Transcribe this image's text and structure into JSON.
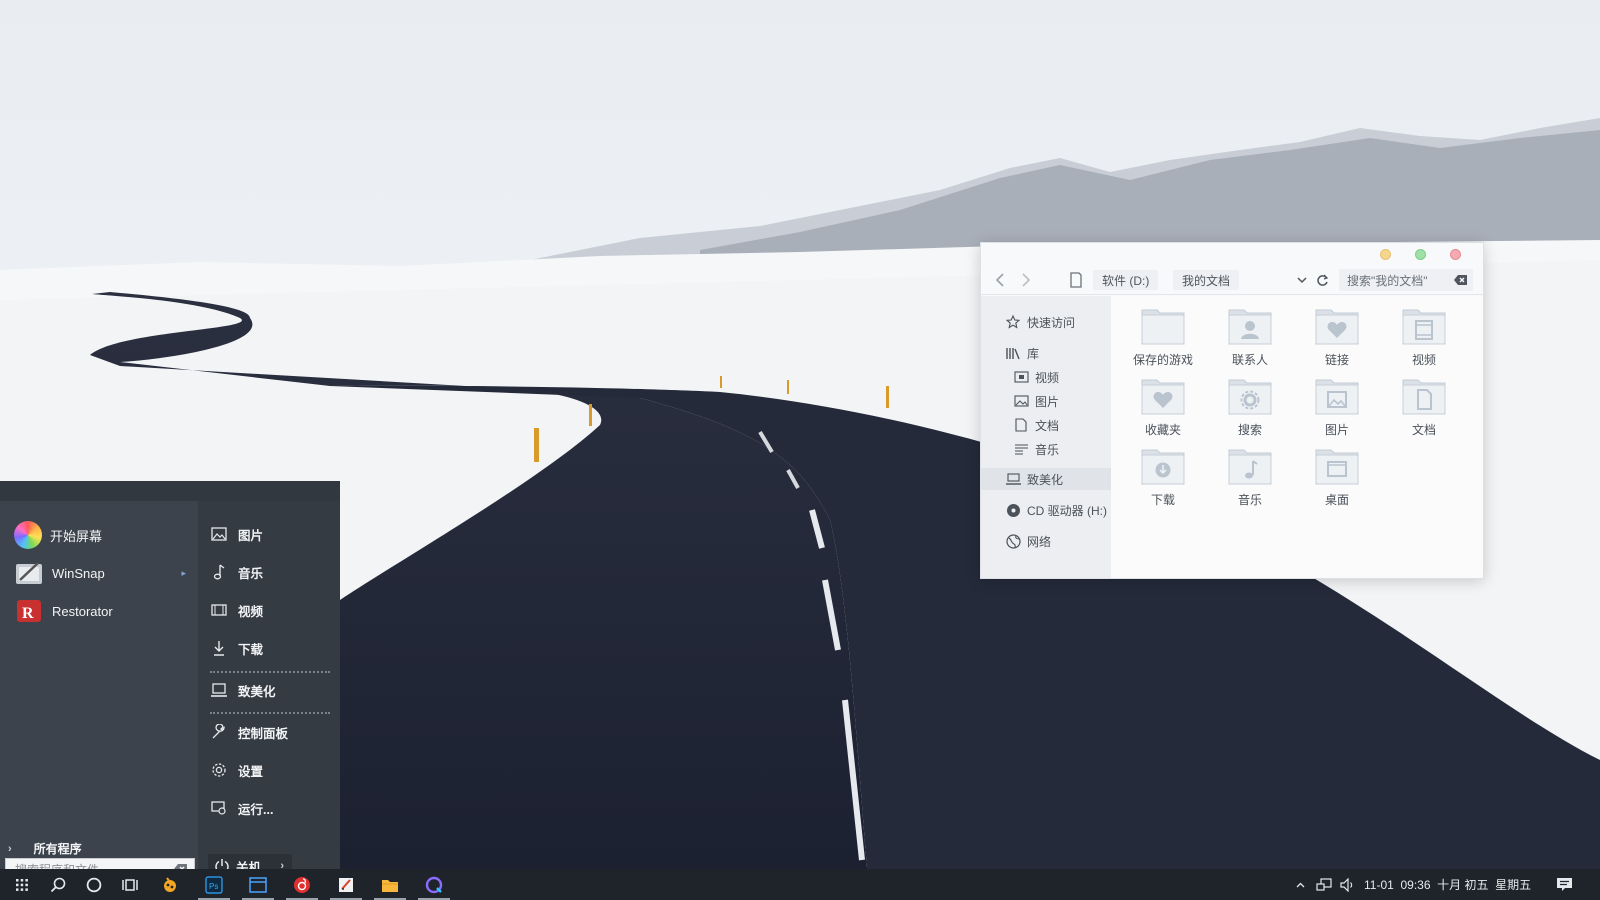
{
  "start_menu": {
    "pinned_apps": [
      {
        "label": "开始屏幕",
        "icon": "color-wheel-icon"
      },
      {
        "label": "WinSnap",
        "icon": "winsnap-icon",
        "has_submenu": true
      },
      {
        "label": "Restorator",
        "icon": "restorator-icon"
      }
    ],
    "all_programs_label": "所有程序",
    "search_placeholder": "搜索程序和文件",
    "places": [
      {
        "label": "图片",
        "icon": "image-icon"
      },
      {
        "label": "音乐",
        "icon": "music-note-icon"
      },
      {
        "label": "视频",
        "icon": "video-icon"
      },
      {
        "label": "下载",
        "icon": "download-icon"
      },
      {
        "label": "致美化",
        "icon": "computer-icon"
      },
      {
        "label": "控制面板",
        "icon": "wrench-icon"
      },
      {
        "label": "设置",
        "icon": "gear-icon"
      },
      {
        "label": "运行...",
        "icon": "run-icon"
      }
    ],
    "shutdown_label": "关机"
  },
  "explorer": {
    "breadcrumb": [
      "软件 (D:)",
      "我的文档"
    ],
    "search_placeholder": "搜索\"我的文档\"",
    "sidebar": {
      "quick_access": "快速访问",
      "library": "库",
      "library_items": [
        "视频",
        "图片",
        "文档",
        "音乐"
      ],
      "this_pc": "致美化",
      "cd_drive": "CD 驱动器 (H:)",
      "network": "网络"
    },
    "folders": [
      {
        "label": "保存的游戏",
        "icon": "folder-icon"
      },
      {
        "label": "联系人",
        "icon": "folder-contacts-icon"
      },
      {
        "label": "链接",
        "icon": "folder-links-icon"
      },
      {
        "label": "视频",
        "icon": "folder-video-icon"
      },
      {
        "label": "收藏夹",
        "icon": "folder-favorites-icon"
      },
      {
        "label": "搜索",
        "icon": "folder-search-icon"
      },
      {
        "label": "图片",
        "icon": "folder-pictures-icon"
      },
      {
        "label": "文档",
        "icon": "folder-documents-icon"
      },
      {
        "label": "下载",
        "icon": "folder-downloads-icon"
      },
      {
        "label": "音乐",
        "icon": "folder-music-icon"
      },
      {
        "label": "桌面",
        "icon": "folder-desktop-icon"
      }
    ]
  },
  "taskbar": {
    "clock": "11-01  09:36  十月 初五  星期五"
  },
  "colors": {
    "start_menu_bg": "#3a4049",
    "taskbar_bg": "#1f232a",
    "window_bg": "#f8f9fa",
    "traffic_yellow": "#f6d58f",
    "traffic_green": "#9fe0a6",
    "traffic_red": "#f5a9b0"
  }
}
